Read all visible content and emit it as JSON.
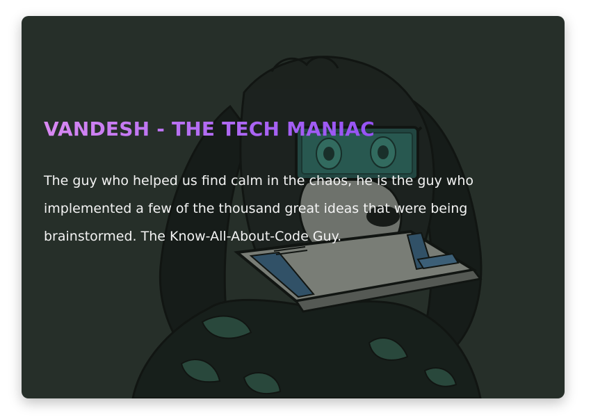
{
  "card": {
    "title": "VANDESH - THE TECH MANIAC",
    "description": "The guy who helped us find calm in the chaos, he is the guy who implemented a few of the thousand great ideas that were being brainstormed. The Know-All-About-Code Guy."
  },
  "colors": {
    "card_background": "#262f29",
    "title_gradient_start": "#d989f2",
    "title_gradient_end": "#9552f4",
    "body_text": "#f3f3f3"
  },
  "illustration": {
    "subject": "dog-illustration",
    "accessories": [
      "vr-goggles",
      "laptop-in-mouth",
      "leaf-pattern-shirt"
    ]
  }
}
